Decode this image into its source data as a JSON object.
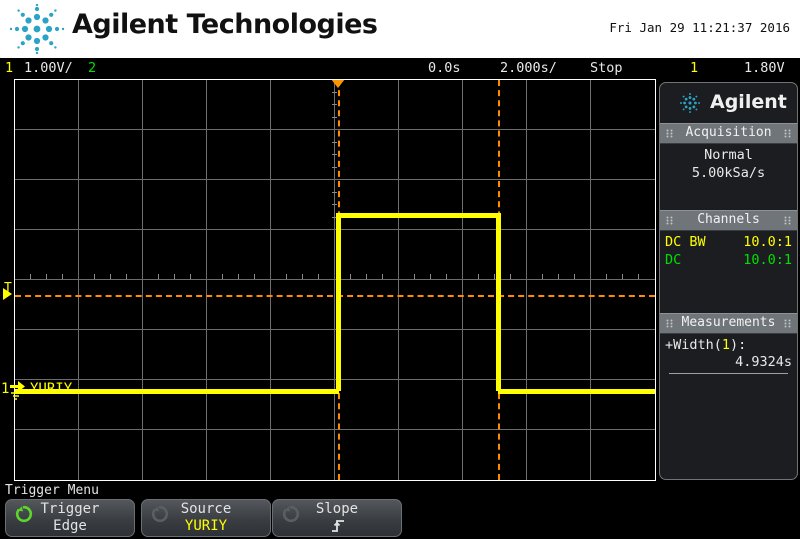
{
  "header": {
    "brand": "Agilent Technologies",
    "logo_icon": "agilent-starburst-icon",
    "datetime": "Fri Jan 29 11:21:37 2016"
  },
  "statusbar": {
    "channel1": "1",
    "channel1_scale": "1.00V/",
    "channel2": "2",
    "delay": "0.0s",
    "timebase": "2.000s/",
    "run_state": "Stop",
    "trigger_slope_icon": "rising-edge-icon",
    "trigger_source": "1",
    "trigger_level": "1.80V"
  },
  "display": {
    "trigger_marker": "T",
    "channel1_marker": "1",
    "channel1_ground_icon": "ground-icon",
    "channel1_label": "YURIY",
    "trigger_position_icon": "trigger-position-marker-icon",
    "colors": {
      "channel1": "#ffff00",
      "channel2": "#00e000",
      "cursor": "#ff8c00",
      "grid": "#6d6d6d",
      "border": "#ffffff"
    }
  },
  "sidepanel": {
    "brand": "Agilent",
    "logo_icon": "agilent-starburst-icon",
    "sections": [
      {
        "title": "Acquisition",
        "rows": [
          {
            "center": "Normal"
          },
          {
            "center": "5.00kSa/s"
          }
        ]
      },
      {
        "title": "Channels",
        "rows": [
          {
            "left": "DC BW",
            "right": "10.0:1",
            "color": "yel"
          },
          {
            "left": "DC",
            "right": "10.0:1",
            "color": "grn"
          }
        ]
      },
      {
        "title": "Measurements",
        "measurement_label_pre": "+Width(",
        "measurement_label_src": "1",
        "measurement_label_post": "):",
        "measurement_value": "4.9324s"
      }
    ]
  },
  "bottom_menu": {
    "title": "Trigger Menu",
    "softkeys": [
      {
        "top": "Trigger",
        "bottom": "Edge",
        "icon": "rotate-knob-icon",
        "icon_active": true,
        "bottom_color": ""
      },
      {
        "top": "Source",
        "bottom": "YURIY",
        "icon": "rotate-knob-icon",
        "icon_active": false,
        "bottom_color": "y"
      },
      {
        "top": "Slope",
        "bottom": "⤨",
        "icon": "rotate-knob-icon",
        "icon_active": false,
        "bottom_color": ""
      }
    ]
  }
}
